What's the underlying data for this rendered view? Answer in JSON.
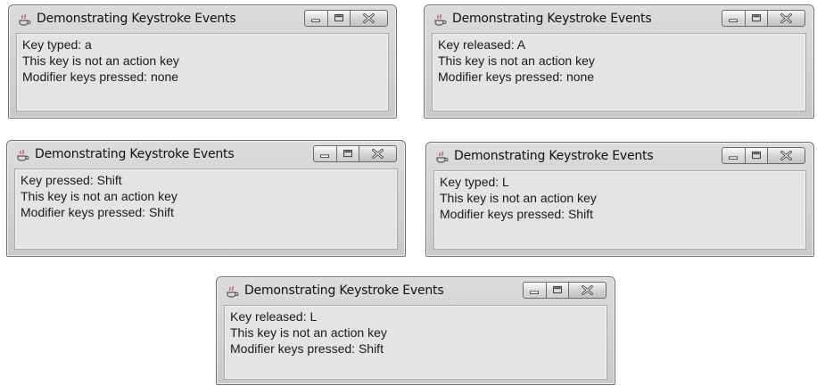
{
  "window_title": "Demonstrating Keystroke Events",
  "icons": {
    "app": "java-cup-icon",
    "minimize": "minimize-icon",
    "maximize": "maximize-icon",
    "close": "close-icon"
  },
  "windows": [
    {
      "key_event": "Key typed: a",
      "action_key": "This key is not an action key",
      "modifiers": "Modifier keys pressed: none"
    },
    {
      "key_event": "Key released: A",
      "action_key": "This key is not an action key",
      "modifiers": "Modifier keys pressed: none"
    },
    {
      "key_event": "Key pressed: Shift",
      "action_key": "This key is not an action key",
      "modifiers": "Modifier keys pressed: Shift"
    },
    {
      "key_event": "Key typed: L",
      "action_key": "This key is not an action key",
      "modifiers": "Modifier keys pressed: Shift"
    },
    {
      "key_event": "Key released: L",
      "action_key": "This key is not an action key",
      "modifiers": "Modifier keys pressed: Shift"
    }
  ]
}
